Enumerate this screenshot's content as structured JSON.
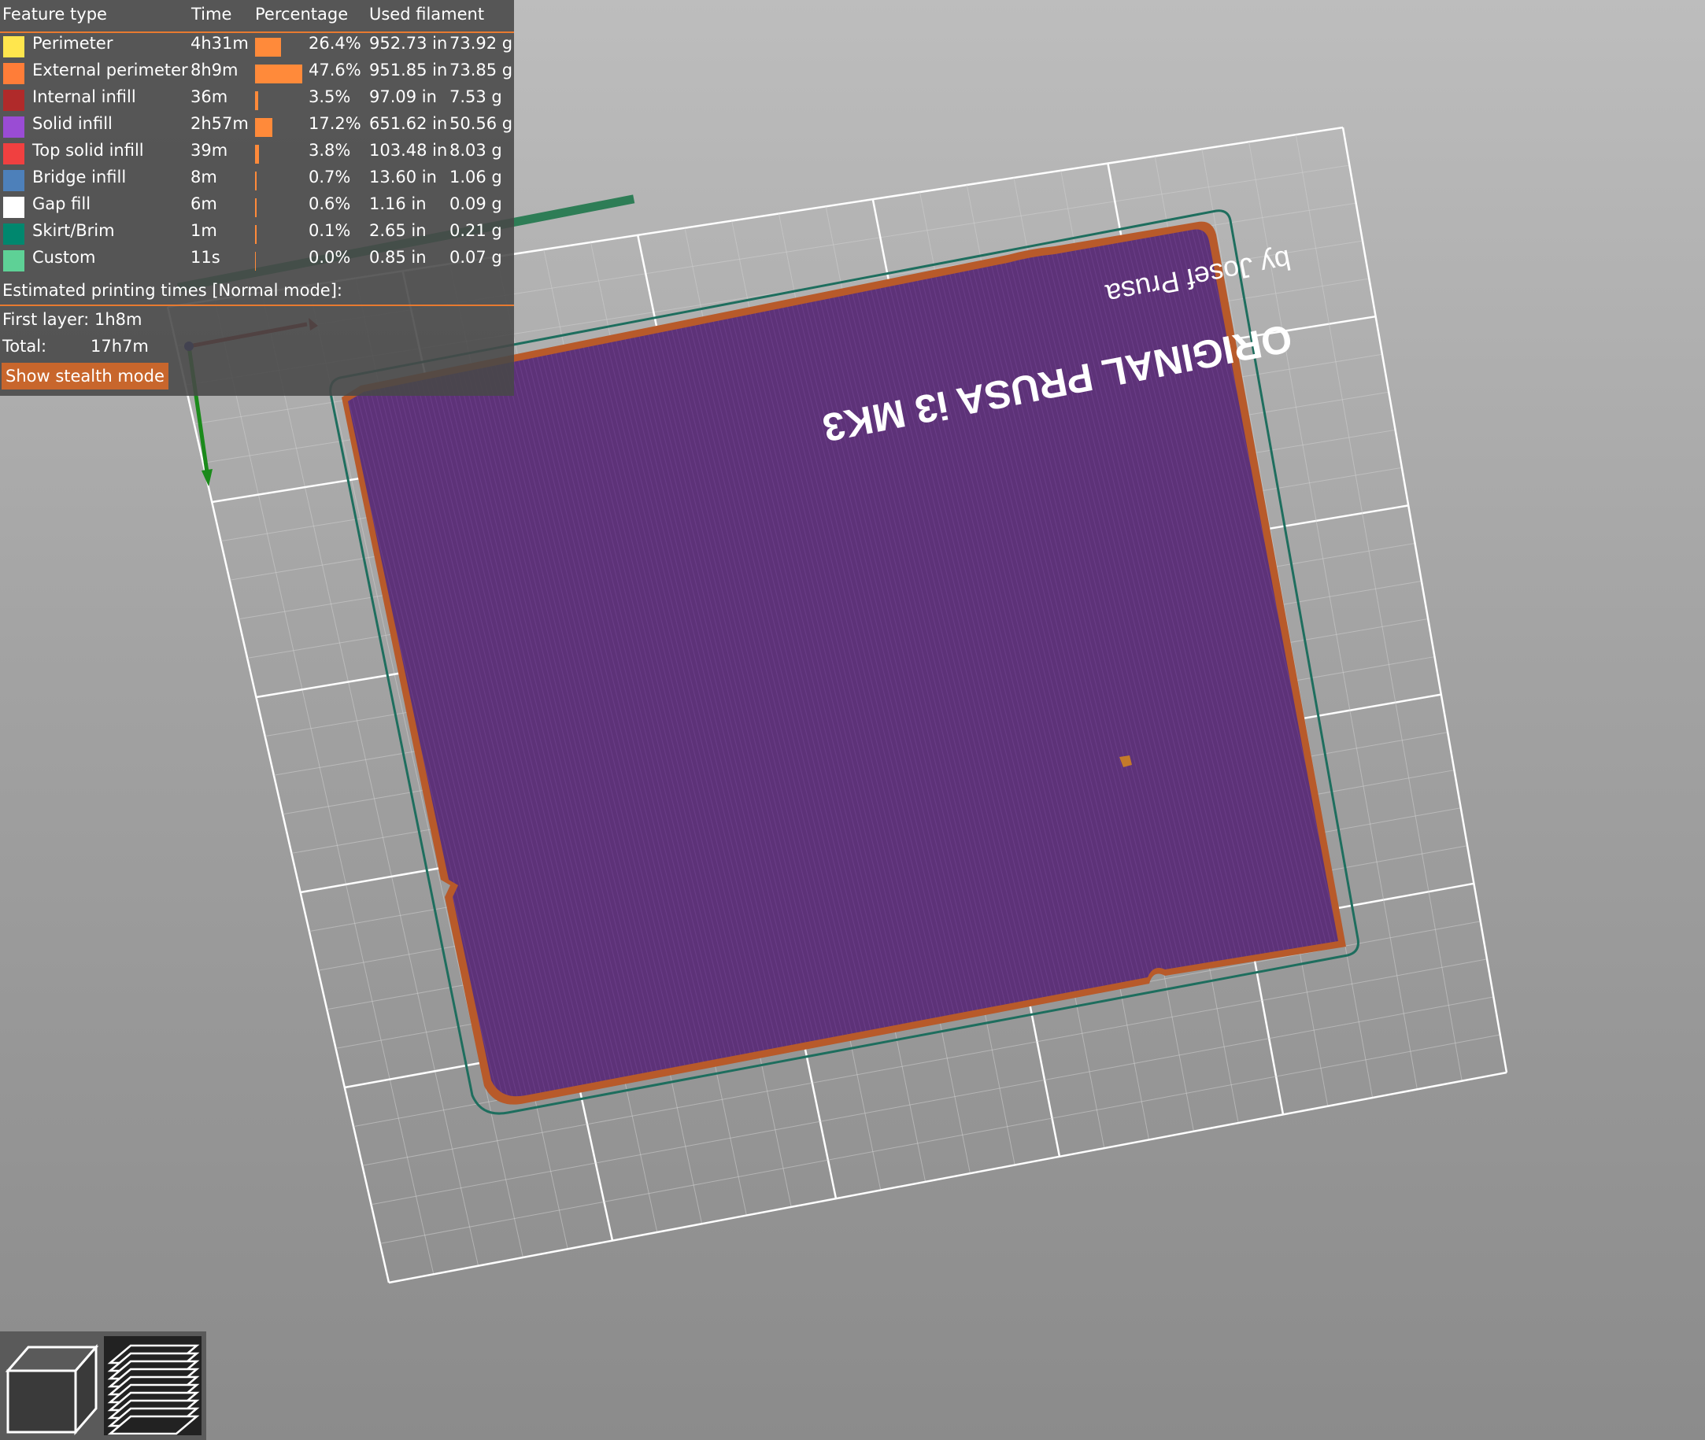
{
  "legend": {
    "headers": {
      "feature_type": "Feature type",
      "time": "Time",
      "percentage": "Percentage",
      "used_filament": "Used filament"
    },
    "rows": [
      {
        "name": "Perimeter",
        "color": "#ffe64d",
        "time": "4h31m",
        "percentage": "26.4%",
        "share": 0.264,
        "length": "952.73 in",
        "weight": "73.92 g"
      },
      {
        "name": "External perimeter",
        "color": "#ff7d38",
        "time": "8h9m",
        "percentage": "47.6%",
        "share": 0.476,
        "length": "951.85 in",
        "weight": "73.85 g"
      },
      {
        "name": "Internal infill",
        "color": "#b02a2a",
        "time": "36m",
        "percentage": "3.5%",
        "share": 0.035,
        "length": "97.09 in",
        "weight": "7.53 g"
      },
      {
        "name": "Solid infill",
        "color": "#9a4cd4",
        "time": "2h57m",
        "percentage": "17.2%",
        "share": 0.172,
        "length": "651.62 in",
        "weight": "50.56 g"
      },
      {
        "name": "Top solid infill",
        "color": "#f04040",
        "time": "39m",
        "percentage": "3.8%",
        "share": 0.038,
        "length": "103.48 in",
        "weight": "8.03 g"
      },
      {
        "name": "Bridge infill",
        "color": "#4d80ba",
        "time": "8m",
        "percentage": "0.7%",
        "share": 0.007,
        "length": "13.60 in",
        "weight": "1.06 g"
      },
      {
        "name": "Gap fill",
        "color": "#ffffff",
        "time": "6m",
        "percentage": "0.6%",
        "share": 0.006,
        "length": "1.16 in",
        "weight": "0.09 g"
      },
      {
        "name": "Skirt/Brim",
        "color": "#00876e",
        "time": "1m",
        "percentage": "0.1%",
        "share": 0.001,
        "length": "2.65 in",
        "weight": "0.21 g"
      },
      {
        "name": "Custom",
        "color": "#5ed196",
        "time": "11s",
        "percentage": "0.0%",
        "share": 0.0,
        "length": "0.85 in",
        "weight": "0.07 g"
      }
    ],
    "estimated_title": "Estimated printing times [Normal mode]:",
    "first_layer_label": "First layer:",
    "first_layer_value": "1h8m",
    "total_label": "Total:",
    "total_value": "17h7m",
    "stealth_button": "Show stealth mode"
  },
  "bed": {
    "text_line1": "ORIGINAL PRUSA i3 MK3",
    "text_line2": "by Josef Prusa"
  },
  "toolbar": {
    "view_3d": "cube-icon",
    "view_preview": "layers-icon"
  }
}
